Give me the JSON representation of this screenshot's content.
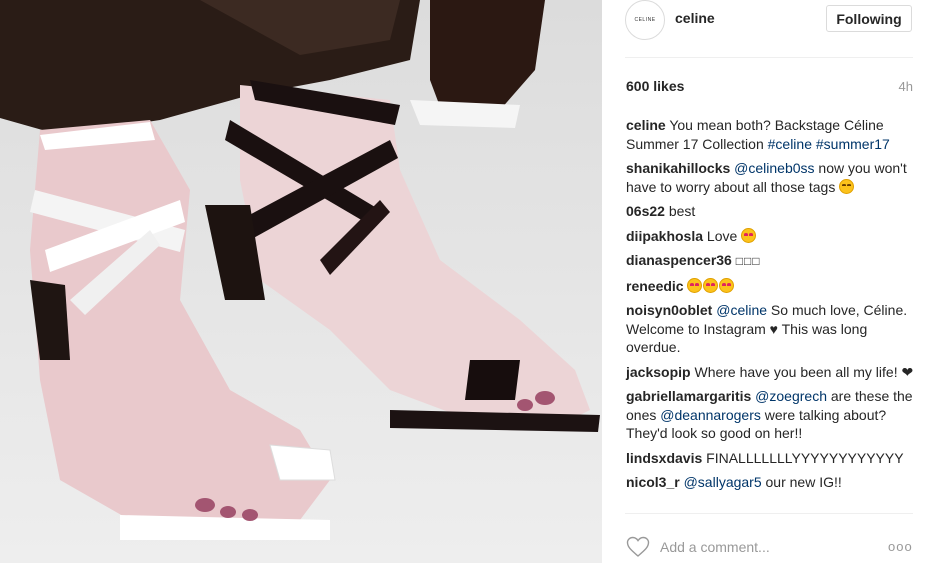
{
  "post": {
    "account_avatar_text": "CELINE",
    "username": "celine",
    "follow_label": "Following",
    "likes": "600 likes",
    "time_ago": "4h"
  },
  "comments": [
    {
      "user": "celine",
      "text_parts": [
        "You mean both? Backstage Céline Summer 17 Collection "
      ],
      "tags": [
        "#celine",
        "#summer17"
      ]
    },
    {
      "user": "shanikahillocks",
      "mention": "@celineb0ss",
      "text": " now you won't have to worry about all those tags "
    },
    {
      "user": "06s22",
      "text": "best"
    },
    {
      "user": "diipakhosla",
      "text": "Love "
    },
    {
      "user": "dianaspencer36",
      "text": "□□□"
    },
    {
      "user": "reneedic",
      "text": ""
    },
    {
      "user": "noisyn0oblet",
      "mention": "@celine",
      "text": " So much love, Céline. Welcome to Instagram ♥ This was long overdue."
    },
    {
      "user": "jacksopip",
      "text": "Where have you been all my life! ❤"
    },
    {
      "user": "gabriellamargaritis",
      "mention": "@zoegrech",
      "text": " are these the ones ",
      "mention2": "@deannarogers",
      "text2": " were talking about? They'd look so good on her!!"
    },
    {
      "user": "lindsxdavis",
      "text": "FINALLLLLLLYYYYYYYYYYYY"
    },
    {
      "user": "nicol3_r",
      "mention": "@sallyagar5",
      "text": " our new IG!!"
    }
  ],
  "footer": {
    "add_comment_placeholder": "Add a comment...",
    "more_label": "ooo"
  },
  "icons": {
    "like": "heart-outline-icon",
    "more": "more-options-icon"
  },
  "colors": {
    "link": "#003569",
    "muted": "#999999"
  }
}
